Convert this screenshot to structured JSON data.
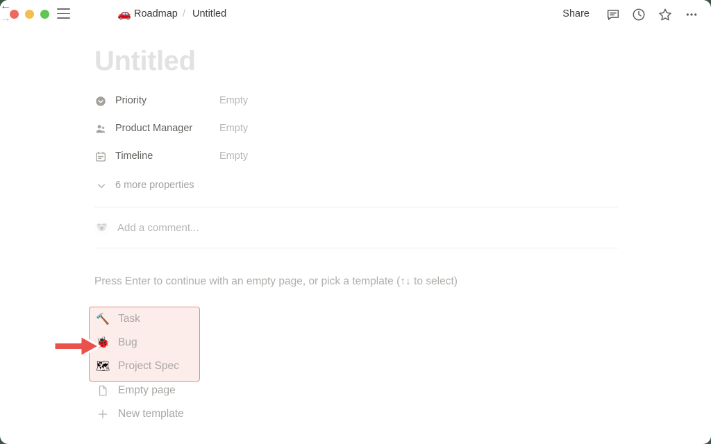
{
  "window": {
    "desktop_background": "#3f5543",
    "background": "#ffffff"
  },
  "titlebar": {
    "traffic_lights": [
      {
        "name": "close",
        "color": "#ee6a5f"
      },
      {
        "name": "minimize",
        "color": "#f5bd4f"
      },
      {
        "name": "maximize",
        "color": "#61c554"
      }
    ],
    "sidebar_toggle_icon": "hamburger-menu-icon",
    "back_icon": "arrow-left-icon",
    "forward_icon": "arrow-right-icon",
    "breadcrumb": {
      "database_emoji": "🚗",
      "database": "Roadmap",
      "separator": "/",
      "page": "Untitled"
    },
    "actions": {
      "share_label": "Share",
      "comments_icon": "comment-bubble-icon",
      "updates_icon": "clock-history-icon",
      "favorite_icon": "star-icon",
      "more_icon": "ellipsis-icon"
    }
  },
  "page": {
    "title": "Untitled",
    "title_is_placeholder": true,
    "properties": [
      {
        "icon": "select-property-icon",
        "label": "Priority",
        "value": "Empty"
      },
      {
        "icon": "person-property-icon",
        "label": "Product Manager",
        "value": "Empty"
      },
      {
        "icon": "date-property-icon",
        "label": "Timeline",
        "value": "Empty"
      }
    ],
    "more_properties": {
      "icon": "chevron-down-icon",
      "label": "6 more properties"
    },
    "comment": {
      "avatar_emoji": "🐨",
      "placeholder": "Add a comment..."
    }
  },
  "template_picker": {
    "hint": "Press Enter to continue with an empty page, or pick a template (↑↓ to select)",
    "highlight": {
      "fill": "#fcedeb",
      "border": "#e98b82"
    },
    "items": [
      {
        "kind": "emoji",
        "emoji": "🔨",
        "icon": "hammer-icon",
        "label": "Task",
        "highlighted": true
      },
      {
        "kind": "emoji",
        "emoji": "🐞",
        "icon": "lady-beetle-icon",
        "label": "Bug",
        "highlighted": true
      },
      {
        "kind": "emoji",
        "emoji": "🗺",
        "icon": "world-map-icon",
        "label": "Project Spec",
        "highlighted": true
      },
      {
        "kind": "svg",
        "emoji": "",
        "icon": "page-icon",
        "label": "Empty page",
        "highlighted": false
      },
      {
        "kind": "svg",
        "emoji": "",
        "icon": "plus-icon",
        "label": "New template",
        "highlighted": false
      }
    ]
  },
  "annotation": {
    "arrow_icon": "red-arrow-right-icon",
    "arrow_color": "#e8524a",
    "points_at": "Bug"
  }
}
